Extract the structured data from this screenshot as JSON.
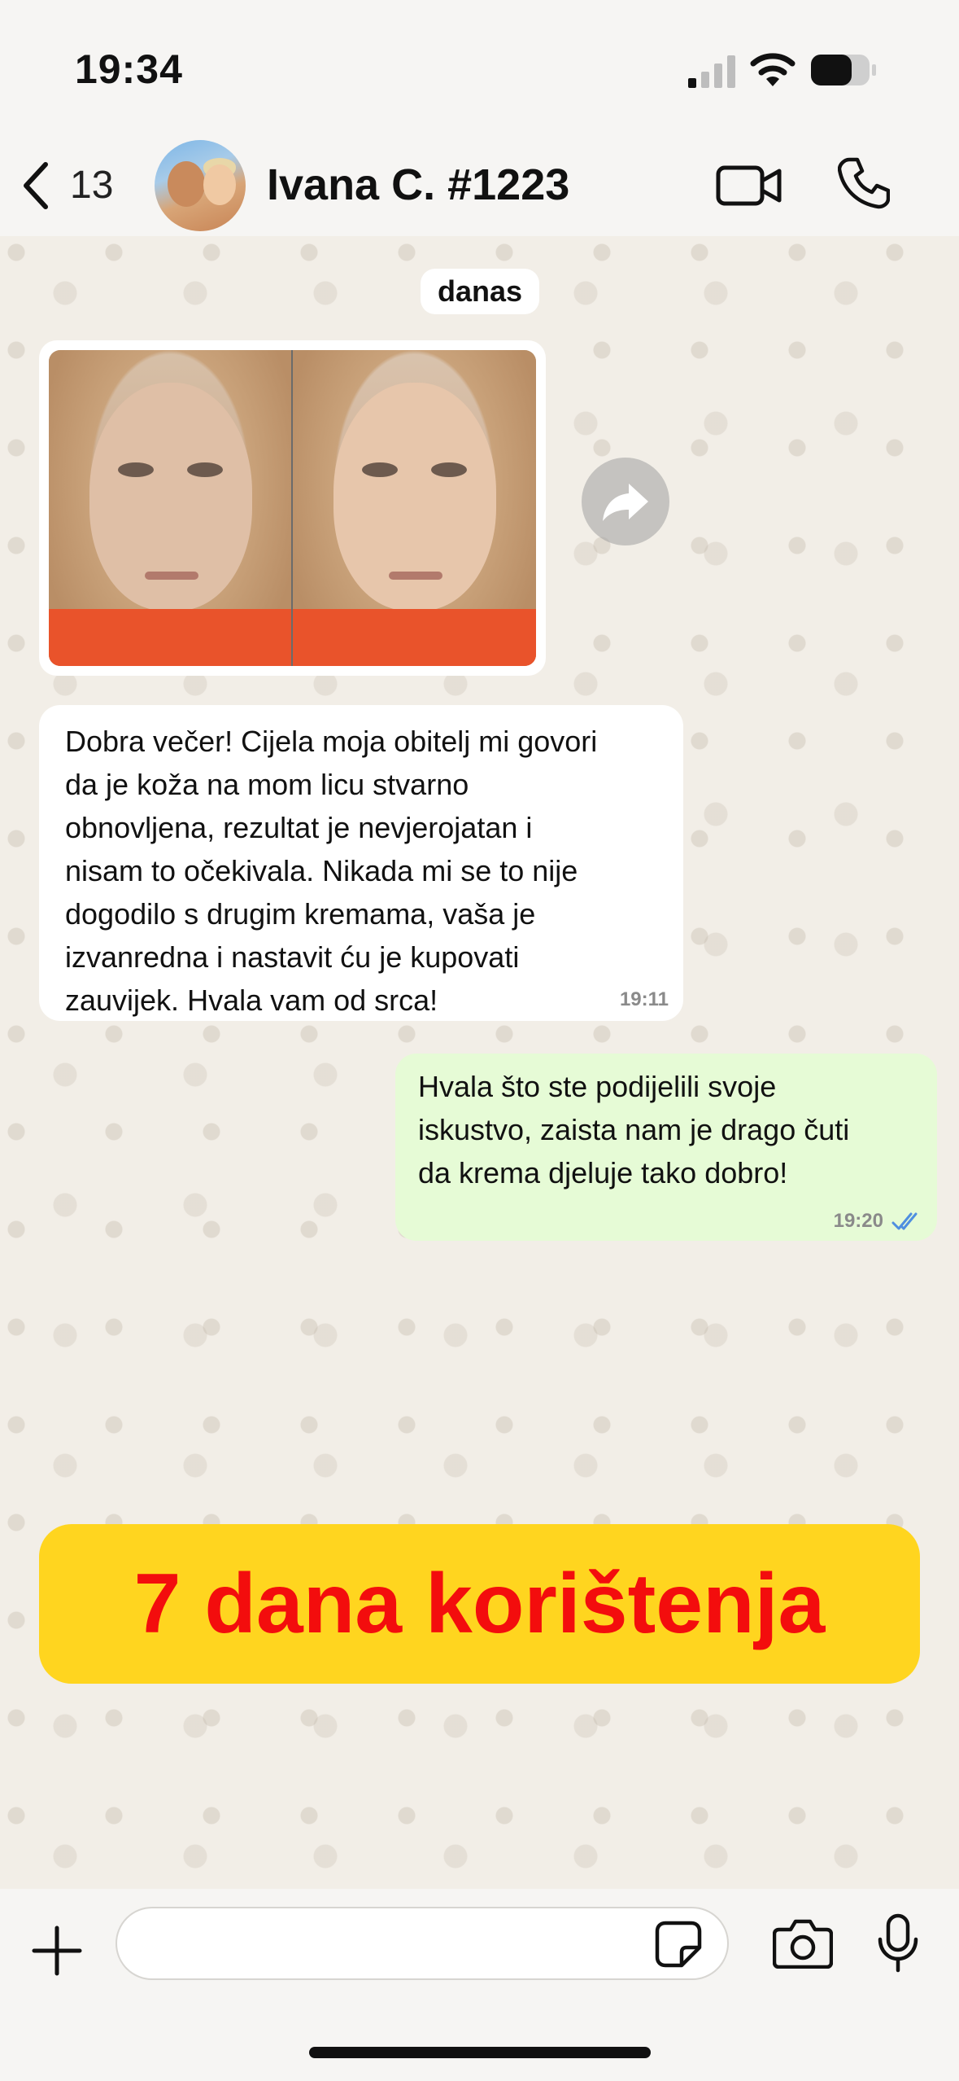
{
  "status_bar": {
    "time": "19:34",
    "icons": [
      "cellular-signal-icon",
      "wifi-icon",
      "battery-icon"
    ]
  },
  "header": {
    "back_icon": "chevron-left-icon",
    "unread_count": "13",
    "contact_name": "Ivana C. #1223",
    "actions": [
      "video-call-icon",
      "phone-call-icon"
    ]
  },
  "chat": {
    "date_label": "danas",
    "image_message": {
      "description_icon": "before-after-photo",
      "forward_icon": "forward-arrow-icon"
    },
    "incoming_message": {
      "text": "Dobra večer! Cijela moja obitelj mi govori da je koža na mom licu stvarno obnovljena, rezultat je nevjerojatan i nisam to očekivala. Nikada mi se to nije dogodilo s drugim kremama, vaša je izvanredna i nastavit ću je kupovati zauvijek. Hvala vam od srca!",
      "lines": [
        "Dobra večer! Cijela moja obitelj mi govori",
        "da je koža na mom licu stvarno",
        "obnovljena, rezultat je nevjerojatan i",
        "nisam to očekivala. Nikada mi se to nije",
        "dogodilo s drugim kremama, vaša je",
        "izvanredna i nastavit ću je kupovati",
        "zauvijek. Hvala vam od srca!"
      ],
      "time": "19:11"
    },
    "outgoing_message": {
      "lines": [
        "Hvala što ste podijelili svoje",
        "iskustvo, zaista nam je drago čuti",
        "da krema djeluje tako dobro!"
      ],
      "time": "19:20",
      "status_icon": "double-check-read-icon"
    }
  },
  "banner": {
    "text": "7 dana korištenja",
    "background": "#ffd51f",
    "color": "#f30d0d"
  },
  "composer": {
    "input_value": "",
    "icons": [
      "plus-icon",
      "sticker-icon",
      "camera-icon",
      "microphone-icon"
    ]
  },
  "colors": {
    "incoming_bubble": "#ffffff",
    "outgoing_bubble": "#e6fbd6",
    "read_receipt": "#4f8fe0"
  }
}
